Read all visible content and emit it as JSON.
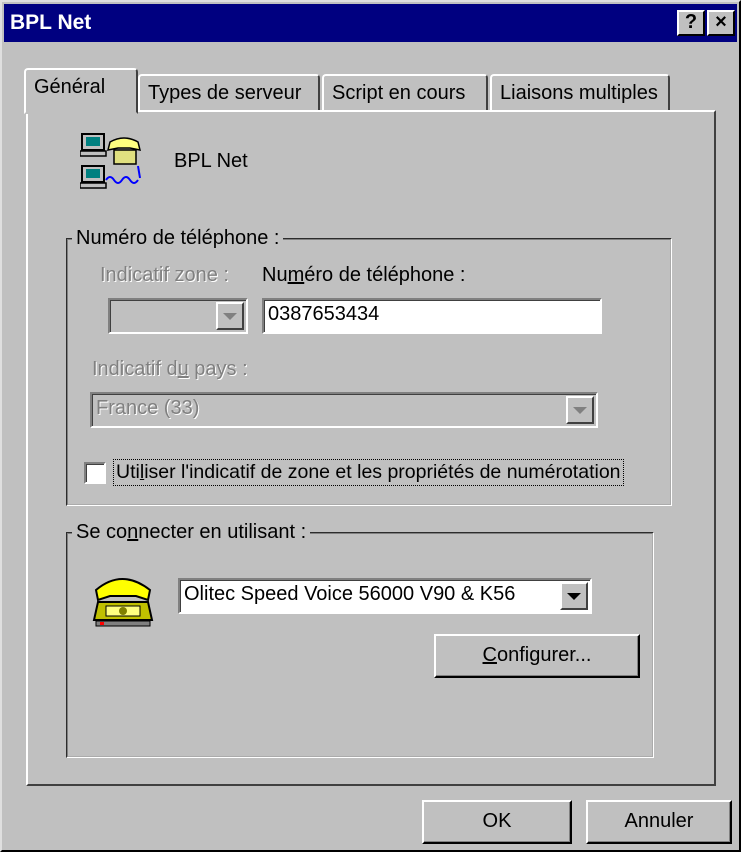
{
  "window": {
    "title": "BPL Net",
    "help_glyph": "?",
    "close_glyph": "×"
  },
  "tabs": [
    {
      "label": "Général",
      "active": true
    },
    {
      "label": "Types de serveur",
      "active": false
    },
    {
      "label": "Script en cours",
      "active": false
    },
    {
      "label": "Liaisons multiples",
      "active": false
    }
  ],
  "connection": {
    "name": "BPL Net",
    "icon": "dialup-computers-phone-icon"
  },
  "phone_group": {
    "legend": "Numéro de téléphone :",
    "area_code_label_pre": "Indicatif zone :",
    "phone_label_pre": "Nu",
    "phone_label_u": "m",
    "phone_label_post": "éro de téléphone :",
    "area_code_value": "",
    "phone_value": "0387653434",
    "country_label_pre": "Indicatif d",
    "country_label_u": "u",
    "country_label_post": " pays :",
    "country_value": "France (33)",
    "use_area_checkbox_pre": "Uti",
    "use_area_checkbox_u": "l",
    "use_area_checkbox_post": "iser l'indicatif de zone et les propriétés de numérotation",
    "use_area_checked": false
  },
  "connect_group": {
    "legend_pre": "Se co",
    "legend_u": "n",
    "legend_post": "necter en utilisant :",
    "modem_icon": "modem-telephone-icon",
    "modem_value": "Olitec Speed Voice 56000 V90 & K56",
    "configure_pre": "",
    "configure_u": "C",
    "configure_post": "onfigurer..."
  },
  "footer": {
    "ok_label": "OK",
    "cancel_label": "Annuler"
  }
}
